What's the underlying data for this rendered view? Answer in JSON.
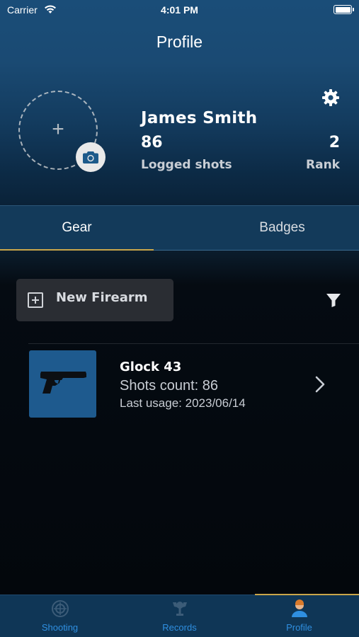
{
  "status_bar": {
    "carrier": "Carrier",
    "time": "4:01 PM"
  },
  "nav": {
    "title": "Profile"
  },
  "profile": {
    "name": "James Smith",
    "logged_shots_value": "86",
    "logged_shots_label": "Logged shots",
    "rank_value": "2",
    "rank_label": "Rank",
    "avatar_placeholder": "+"
  },
  "tabs": [
    {
      "label": "Gear",
      "selected": true
    },
    {
      "label": "Badges",
      "selected": false
    }
  ],
  "gear": {
    "new_firearm_label": "New Firearm",
    "firearms": [
      {
        "name": "Glock 43",
        "shots_count": "Shots count: 86",
        "last_usage": "Last usage: 2023/06/14",
        "thumbnail_icon": "pistol-icon"
      }
    ]
  },
  "tabbar": {
    "items": [
      {
        "label": "Shooting",
        "icon": "target-icon",
        "active": false
      },
      {
        "label": "Records",
        "icon": "trophy-icon",
        "active": false
      },
      {
        "label": "Profile",
        "icon": "person-icon",
        "active": true
      }
    ]
  },
  "colors": {
    "accent_gold": "#c9a54a",
    "tab_blue": "#2f8fe0",
    "header_blue": "#1a4d78",
    "thumb_blue": "#1e5a8e"
  }
}
